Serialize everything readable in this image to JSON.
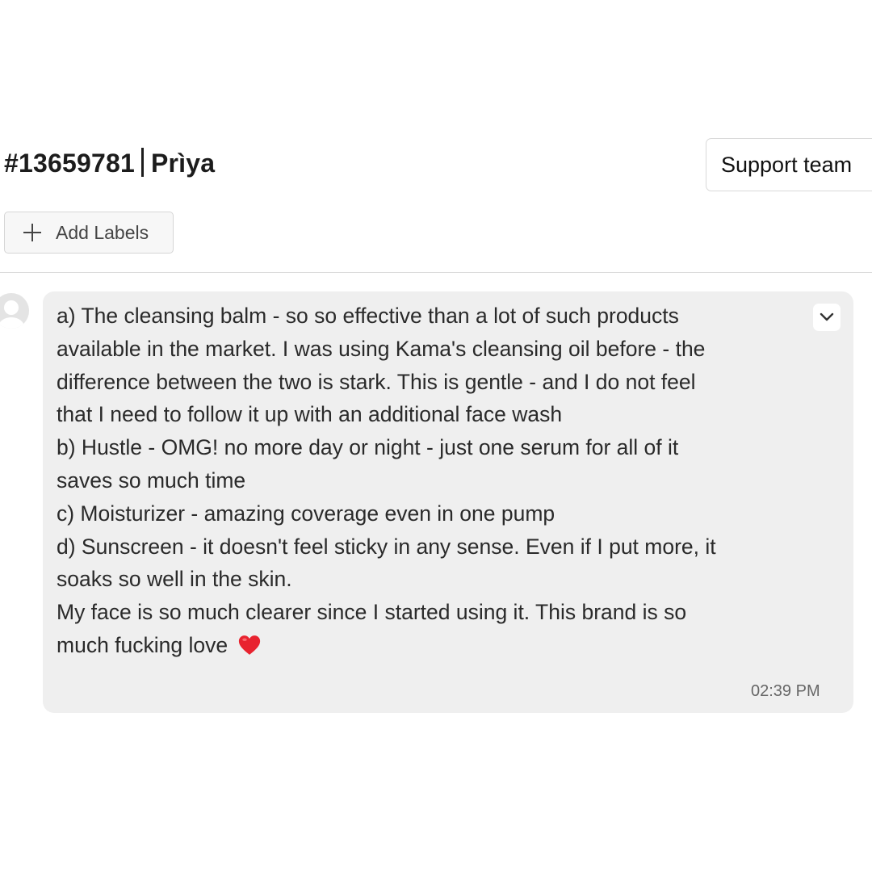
{
  "header": {
    "ticket_id": "#13659781",
    "customer_name": "Prìya",
    "team_button_label": "Support team"
  },
  "labels": {
    "add_labels_text": "Add Labels"
  },
  "message": {
    "lines": [
      "a) The cleansing balm - so so effective than a lot of such products",
      "available in the market. I was using Kama's cleansing oil before - the",
      "difference between the two is stark. This is gentle - and I do not feel",
      "that I need to follow it up with an additional face wash",
      "b) Hustle - OMG! no more day or night - just one serum for all of it",
      "saves so much time",
      "c) Moisturizer - amazing coverage even in one pump",
      "d) Sunscreen - it doesn't feel sticky in any sense. Even if I put more, it",
      "soaks so well in the skin.",
      "My face is so much clearer since I started using it. This brand is so",
      "much fucking love"
    ],
    "emoji": "heart-icon",
    "timestamp": "02:39 PM"
  },
  "colors": {
    "bubble_bg": "#efefef",
    "heart": "#e8232f",
    "divider": "#dcdcdc"
  }
}
